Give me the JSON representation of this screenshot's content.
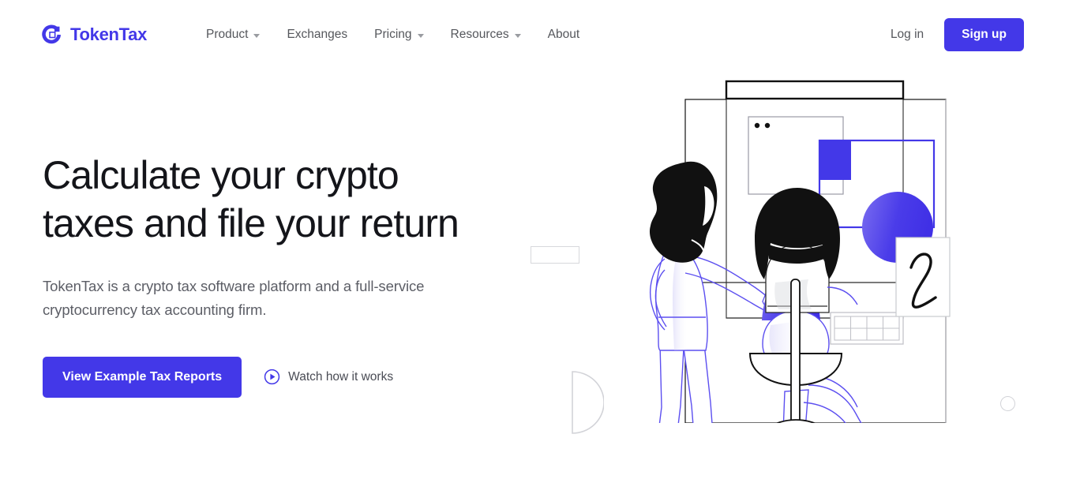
{
  "brand": {
    "name": "TokenTax",
    "logo_icon": "tokentax-logo-icon",
    "accent_color": "#4338e8"
  },
  "header": {
    "nav_items": [
      {
        "label": "Product",
        "has_dropdown": true
      },
      {
        "label": "Exchanges",
        "has_dropdown": false
      },
      {
        "label": "Pricing",
        "has_dropdown": true
      },
      {
        "label": "Resources",
        "has_dropdown": true
      },
      {
        "label": "About",
        "has_dropdown": false
      }
    ],
    "login_label": "Log in",
    "signup_label": "Sign up"
  },
  "hero": {
    "title_line_1": "Calculate your crypto",
    "title_line_2": "taxes and file your return",
    "subtitle": "TokenTax is a crypto tax software platform and a full-service cryptocurrency tax accounting firm.",
    "primary_cta_label": "View Example Tax Reports",
    "secondary_cta_label": "Watch how it works",
    "secondary_cta_icon": "play-circle-icon",
    "illustration_alt": "Two people reviewing crypto tax documents on a screen"
  },
  "decor": {
    "rectangle_outline": "decorative-rectangle",
    "semicircle_outline": "decorative-semicircle",
    "circle_outline": "decorative-circle",
    "outline_color": "#d7d8dc"
  },
  "colors": {
    "accent": "#4338e8",
    "text_primary": "#14151a",
    "text_secondary": "#5c5e66",
    "background": "#ffffff",
    "ink": "#111111"
  }
}
